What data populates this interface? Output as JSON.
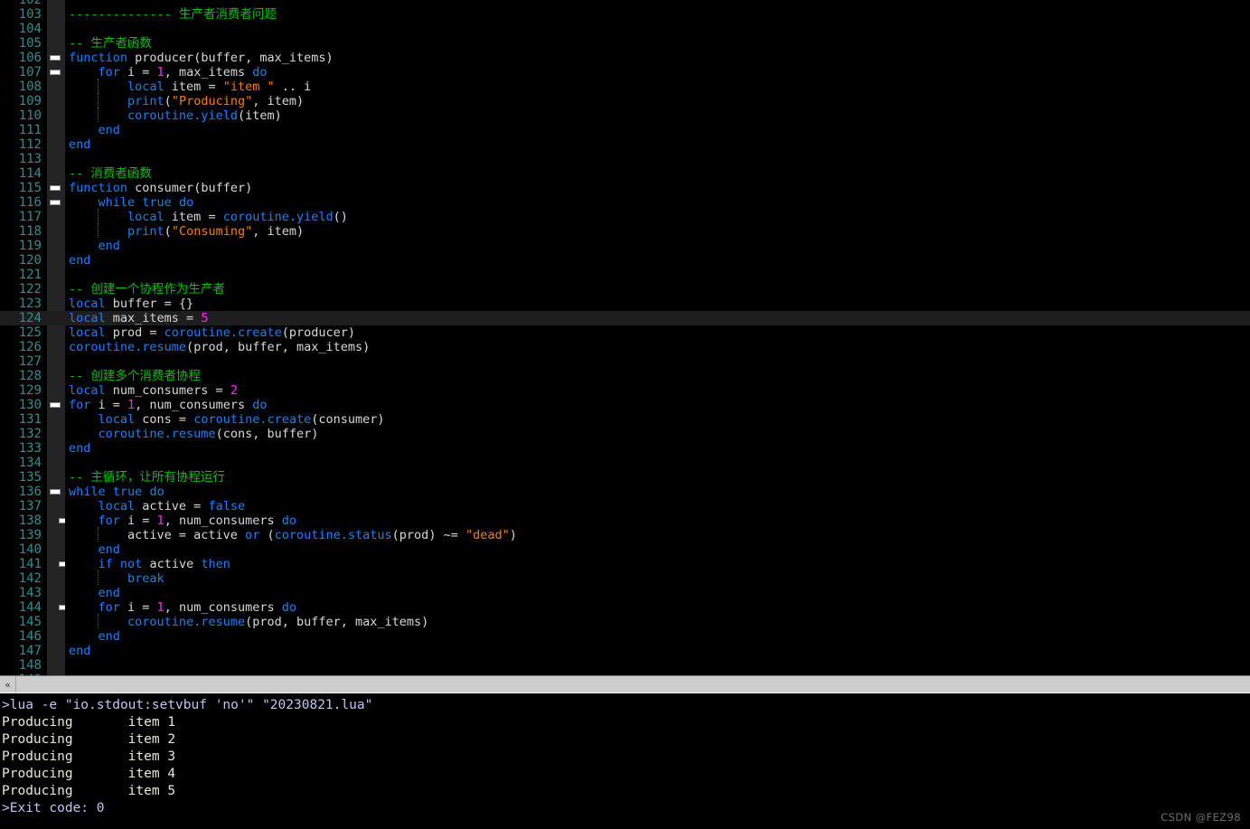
{
  "editor": {
    "language": "lua",
    "colors": {
      "background": "#000000",
      "keyword": "#1a7ffb",
      "number": "#ff27ff",
      "string": "#f08000",
      "comment": "#00c000",
      "identifier": "#d8d8d8",
      "line_number": "#2f8f8f",
      "current_line_bg": "#1e1e1e",
      "fold_margin": "#242424"
    },
    "first_visible_line": 102,
    "last_visible_line": 149,
    "current_line": 124,
    "lines": [
      {
        "n": 102,
        "partial": true,
        "fold": "",
        "indent": 0,
        "guides": 0,
        "tokens": []
      },
      {
        "n": 103,
        "fold": "",
        "indent": 0,
        "guides": 0,
        "tokens": [
          {
            "t": "cmt",
            "v": "-------------- 生产者消费者问题"
          }
        ]
      },
      {
        "n": 104,
        "fold": "",
        "indent": 0,
        "guides": 0,
        "tokens": []
      },
      {
        "n": 105,
        "fold": "",
        "indent": 0,
        "guides": 0,
        "tokens": [
          {
            "t": "cmt",
            "v": "-- 生产者函数"
          }
        ]
      },
      {
        "n": 106,
        "fold": "open",
        "indent": 0,
        "guides": 0,
        "tokens": [
          {
            "t": "kw",
            "v": "function"
          },
          {
            "t": "id",
            "v": " producer"
          },
          {
            "t": "punc",
            "v": "("
          },
          {
            "t": "id",
            "v": "buffer, max_items"
          },
          {
            "t": "punc",
            "v": ")"
          }
        ]
      },
      {
        "n": 107,
        "fold": "open",
        "indent": 0,
        "guides": 0,
        "tokens": [
          {
            "t": "id",
            "v": "    "
          },
          {
            "t": "kw",
            "v": "for"
          },
          {
            "t": "id",
            "v": " i = "
          },
          {
            "t": "num",
            "v": "1"
          },
          {
            "t": "id",
            "v": ", max_items "
          },
          {
            "t": "kw",
            "v": "do"
          }
        ]
      },
      {
        "n": 108,
        "fold": "",
        "indent": 0,
        "guides": 1,
        "tokens": [
          {
            "t": "id",
            "v": "        "
          },
          {
            "t": "kw",
            "v": "local"
          },
          {
            "t": "id",
            "v": " item = "
          },
          {
            "t": "str",
            "v": "\"item \""
          },
          {
            "t": "id",
            "v": " .. i"
          }
        ]
      },
      {
        "n": 109,
        "fold": "",
        "indent": 0,
        "guides": 1,
        "tokens": [
          {
            "t": "id",
            "v": "        "
          },
          {
            "t": "lib",
            "v": "print"
          },
          {
            "t": "punc",
            "v": "("
          },
          {
            "t": "str",
            "v": "\"Producing\""
          },
          {
            "t": "id",
            "v": ", item"
          },
          {
            "t": "punc",
            "v": ")"
          }
        ]
      },
      {
        "n": 110,
        "fold": "",
        "indent": 0,
        "guides": 1,
        "tokens": [
          {
            "t": "id",
            "v": "        "
          },
          {
            "t": "lib",
            "v": "coroutine.yield"
          },
          {
            "t": "punc",
            "v": "("
          },
          {
            "t": "id",
            "v": "item"
          },
          {
            "t": "punc",
            "v": ")"
          }
        ]
      },
      {
        "n": 111,
        "fold": "",
        "indent": 0,
        "guides": 0,
        "tokens": [
          {
            "t": "id",
            "v": "    "
          },
          {
            "t": "kw",
            "v": "end"
          }
        ]
      },
      {
        "n": 112,
        "fold": "",
        "indent": 0,
        "guides": 0,
        "tokens": [
          {
            "t": "kw",
            "v": "end"
          }
        ]
      },
      {
        "n": 113,
        "fold": "",
        "indent": 0,
        "guides": 0,
        "tokens": []
      },
      {
        "n": 114,
        "fold": "",
        "indent": 0,
        "guides": 0,
        "tokens": [
          {
            "t": "cmt",
            "v": "-- 消费者函数"
          }
        ]
      },
      {
        "n": 115,
        "fold": "open",
        "indent": 0,
        "guides": 0,
        "tokens": [
          {
            "t": "kw",
            "v": "function"
          },
          {
            "t": "id",
            "v": " consumer"
          },
          {
            "t": "punc",
            "v": "("
          },
          {
            "t": "id",
            "v": "buffer"
          },
          {
            "t": "punc",
            "v": ")"
          }
        ]
      },
      {
        "n": 116,
        "fold": "open",
        "indent": 0,
        "guides": 0,
        "tokens": [
          {
            "t": "id",
            "v": "    "
          },
          {
            "t": "kw",
            "v": "while"
          },
          {
            "t": "id",
            "v": " "
          },
          {
            "t": "kw",
            "v": "true"
          },
          {
            "t": "id",
            "v": " "
          },
          {
            "t": "kw",
            "v": "do"
          }
        ]
      },
      {
        "n": 117,
        "fold": "",
        "indent": 0,
        "guides": 1,
        "tokens": [
          {
            "t": "id",
            "v": "        "
          },
          {
            "t": "kw",
            "v": "local"
          },
          {
            "t": "id",
            "v": " item = "
          },
          {
            "t": "lib",
            "v": "coroutine.yield"
          },
          {
            "t": "punc",
            "v": "()"
          }
        ]
      },
      {
        "n": 118,
        "fold": "",
        "indent": 0,
        "guides": 1,
        "tokens": [
          {
            "t": "id",
            "v": "        "
          },
          {
            "t": "lib",
            "v": "print"
          },
          {
            "t": "punc",
            "v": "("
          },
          {
            "t": "str",
            "v": "\"Consuming\""
          },
          {
            "t": "id",
            "v": ", item"
          },
          {
            "t": "punc",
            "v": ")"
          }
        ]
      },
      {
        "n": 119,
        "fold": "",
        "indent": 0,
        "guides": 0,
        "tokens": [
          {
            "t": "id",
            "v": "    "
          },
          {
            "t": "kw",
            "v": "end"
          }
        ]
      },
      {
        "n": 120,
        "fold": "",
        "indent": 0,
        "guides": 0,
        "tokens": [
          {
            "t": "kw",
            "v": "end"
          }
        ]
      },
      {
        "n": 121,
        "fold": "",
        "indent": 0,
        "guides": 0,
        "tokens": []
      },
      {
        "n": 122,
        "fold": "",
        "indent": 0,
        "guides": 0,
        "tokens": [
          {
            "t": "cmt",
            "v": "-- 创建一个协程作为生产者"
          }
        ]
      },
      {
        "n": 123,
        "fold": "",
        "indent": 0,
        "guides": 0,
        "tokens": [
          {
            "t": "kw",
            "v": "local"
          },
          {
            "t": "id",
            "v": " buffer = "
          },
          {
            "t": "punc",
            "v": "{}"
          }
        ]
      },
      {
        "n": 124,
        "fold": "",
        "indent": 0,
        "guides": 0,
        "current": true,
        "tokens": [
          {
            "t": "kw",
            "v": "local"
          },
          {
            "t": "id",
            "v": " max_items = "
          },
          {
            "t": "num",
            "v": "5"
          }
        ]
      },
      {
        "n": 125,
        "fold": "",
        "indent": 0,
        "guides": 0,
        "tokens": [
          {
            "t": "kw",
            "v": "local"
          },
          {
            "t": "id",
            "v": " prod = "
          },
          {
            "t": "lib",
            "v": "coroutine.create"
          },
          {
            "t": "punc",
            "v": "("
          },
          {
            "t": "id",
            "v": "producer"
          },
          {
            "t": "punc",
            "v": ")"
          }
        ]
      },
      {
        "n": 126,
        "fold": "",
        "indent": 0,
        "guides": 0,
        "tokens": [
          {
            "t": "lib",
            "v": "coroutine.resume"
          },
          {
            "t": "punc",
            "v": "("
          },
          {
            "t": "id",
            "v": "prod, buffer, max_items"
          },
          {
            "t": "punc",
            "v": ")"
          }
        ]
      },
      {
        "n": 127,
        "fold": "",
        "indent": 0,
        "guides": 0,
        "tokens": []
      },
      {
        "n": 128,
        "fold": "",
        "indent": 0,
        "guides": 0,
        "tokens": [
          {
            "t": "cmt",
            "v": "-- 创建多个消费者协程"
          }
        ]
      },
      {
        "n": 129,
        "fold": "",
        "indent": 0,
        "guides": 0,
        "tokens": [
          {
            "t": "kw",
            "v": "local"
          },
          {
            "t": "id",
            "v": " num_consumers = "
          },
          {
            "t": "num",
            "v": "2"
          }
        ]
      },
      {
        "n": 130,
        "fold": "open",
        "indent": 0,
        "guides": 0,
        "tokens": [
          {
            "t": "kw",
            "v": "for"
          },
          {
            "t": "id",
            "v": " i = "
          },
          {
            "t": "num",
            "v": "1"
          },
          {
            "t": "id",
            "v": ", num_consumers "
          },
          {
            "t": "kw",
            "v": "do"
          }
        ]
      },
      {
        "n": 131,
        "fold": "",
        "indent": 0,
        "guides": 0,
        "tokens": [
          {
            "t": "id",
            "v": "    "
          },
          {
            "t": "kw",
            "v": "local"
          },
          {
            "t": "id",
            "v": " cons = "
          },
          {
            "t": "lib",
            "v": "coroutine.create"
          },
          {
            "t": "punc",
            "v": "("
          },
          {
            "t": "id",
            "v": "consumer"
          },
          {
            "t": "punc",
            "v": ")"
          }
        ]
      },
      {
        "n": 132,
        "fold": "",
        "indent": 0,
        "guides": 0,
        "tokens": [
          {
            "t": "id",
            "v": "    "
          },
          {
            "t": "lib",
            "v": "coroutine.resume"
          },
          {
            "t": "punc",
            "v": "("
          },
          {
            "t": "id",
            "v": "cons, buffer"
          },
          {
            "t": "punc",
            "v": ")"
          }
        ]
      },
      {
        "n": 133,
        "fold": "",
        "indent": 0,
        "guides": 0,
        "tokens": [
          {
            "t": "kw",
            "v": "end"
          }
        ]
      },
      {
        "n": 134,
        "fold": "",
        "indent": 0,
        "guides": 0,
        "tokens": []
      },
      {
        "n": 135,
        "fold": "",
        "indent": 0,
        "guides": 0,
        "tokens": [
          {
            "t": "cmt",
            "v": "-- 主循环，让所有协程运行"
          }
        ]
      },
      {
        "n": 136,
        "fold": "open",
        "indent": 0,
        "guides": 0,
        "tokens": [
          {
            "t": "kw",
            "v": "while"
          },
          {
            "t": "id",
            "v": " "
          },
          {
            "t": "kw",
            "v": "true"
          },
          {
            "t": "id",
            "v": " "
          },
          {
            "t": "kw",
            "v": "do"
          }
        ]
      },
      {
        "n": 137,
        "fold": "",
        "indent": 0,
        "guides": 0,
        "tokens": [
          {
            "t": "id",
            "v": "    "
          },
          {
            "t": "kw",
            "v": "local"
          },
          {
            "t": "id",
            "v": " active = "
          },
          {
            "t": "kw",
            "v": "false"
          }
        ]
      },
      {
        "n": 138,
        "fold": "open",
        "indent": 1,
        "guides": 0,
        "tokens": [
          {
            "t": "id",
            "v": "    "
          },
          {
            "t": "kw",
            "v": "for"
          },
          {
            "t": "id",
            "v": " i = "
          },
          {
            "t": "num",
            "v": "1"
          },
          {
            "t": "id",
            "v": ", num_consumers "
          },
          {
            "t": "kw",
            "v": "do"
          }
        ]
      },
      {
        "n": 139,
        "fold": "",
        "indent": 0,
        "guides": 1,
        "tokens": [
          {
            "t": "id",
            "v": "        active = active "
          },
          {
            "t": "kw",
            "v": "or"
          },
          {
            "t": "punc",
            "v": " ("
          },
          {
            "t": "lib",
            "v": "coroutine.status"
          },
          {
            "t": "punc",
            "v": "("
          },
          {
            "t": "id",
            "v": "prod"
          },
          {
            "t": "punc",
            "v": ") "
          },
          {
            "t": "op",
            "v": "~="
          },
          {
            "t": "id",
            "v": " "
          },
          {
            "t": "str",
            "v": "\"dead\""
          },
          {
            "t": "punc",
            "v": ")"
          }
        ]
      },
      {
        "n": 140,
        "fold": "",
        "indent": 0,
        "guides": 0,
        "tokens": [
          {
            "t": "id",
            "v": "    "
          },
          {
            "t": "kw",
            "v": "end"
          }
        ]
      },
      {
        "n": 141,
        "fold": "open",
        "indent": 1,
        "guides": 0,
        "tokens": [
          {
            "t": "id",
            "v": "    "
          },
          {
            "t": "kw",
            "v": "if"
          },
          {
            "t": "id",
            "v": " "
          },
          {
            "t": "kw",
            "v": "not"
          },
          {
            "t": "id",
            "v": " active "
          },
          {
            "t": "kw",
            "v": "then"
          }
        ]
      },
      {
        "n": 142,
        "fold": "",
        "indent": 0,
        "guides": 1,
        "tokens": [
          {
            "t": "id",
            "v": "        "
          },
          {
            "t": "kw",
            "v": "break"
          }
        ]
      },
      {
        "n": 143,
        "fold": "",
        "indent": 0,
        "guides": 0,
        "tokens": [
          {
            "t": "id",
            "v": "    "
          },
          {
            "t": "kw",
            "v": "end"
          }
        ]
      },
      {
        "n": 144,
        "fold": "open",
        "indent": 1,
        "guides": 0,
        "tokens": [
          {
            "t": "id",
            "v": "    "
          },
          {
            "t": "kw",
            "v": "for"
          },
          {
            "t": "id",
            "v": " i = "
          },
          {
            "t": "num",
            "v": "1"
          },
          {
            "t": "id",
            "v": ", num_consumers "
          },
          {
            "t": "kw",
            "v": "do"
          }
        ]
      },
      {
        "n": 145,
        "fold": "",
        "indent": 0,
        "guides": 1,
        "tokens": [
          {
            "t": "id",
            "v": "        "
          },
          {
            "t": "lib",
            "v": "coroutine.resume"
          },
          {
            "t": "punc",
            "v": "("
          },
          {
            "t": "id",
            "v": "prod, buffer, max_items"
          },
          {
            "t": "punc",
            "v": ")"
          }
        ]
      },
      {
        "n": 146,
        "fold": "",
        "indent": 0,
        "guides": 0,
        "tokens": [
          {
            "t": "id",
            "v": "    "
          },
          {
            "t": "kw",
            "v": "end"
          }
        ]
      },
      {
        "n": 147,
        "fold": "",
        "indent": 0,
        "guides": 0,
        "tokens": [
          {
            "t": "kw",
            "v": "end"
          }
        ]
      },
      {
        "n": 148,
        "fold": "",
        "indent": 0,
        "guides": 0,
        "tokens": []
      },
      {
        "n": 149,
        "partial": true,
        "fold": "",
        "indent": 0,
        "guides": 0,
        "tokens": []
      }
    ]
  },
  "scrollbar": {
    "orientation": "horizontal",
    "left_arrow_glyph": "«",
    "thumb_position": "full"
  },
  "terminal": {
    "lines": [
      {
        "type": "prompt",
        "text": ">lua -e \"io.stdout:setvbuf 'no'\" \"20230821.lua\""
      },
      {
        "type": "output",
        "text": "Producing       item 1"
      },
      {
        "type": "output",
        "text": "Producing       item 2"
      },
      {
        "type": "output",
        "text": "Producing       item 3"
      },
      {
        "type": "output",
        "text": "Producing       item 4"
      },
      {
        "type": "output",
        "text": "Producing       item 5"
      },
      {
        "type": "prompt",
        "text": ">Exit code: 0"
      }
    ]
  },
  "watermark": {
    "text": "CSDN @FEZ98"
  }
}
